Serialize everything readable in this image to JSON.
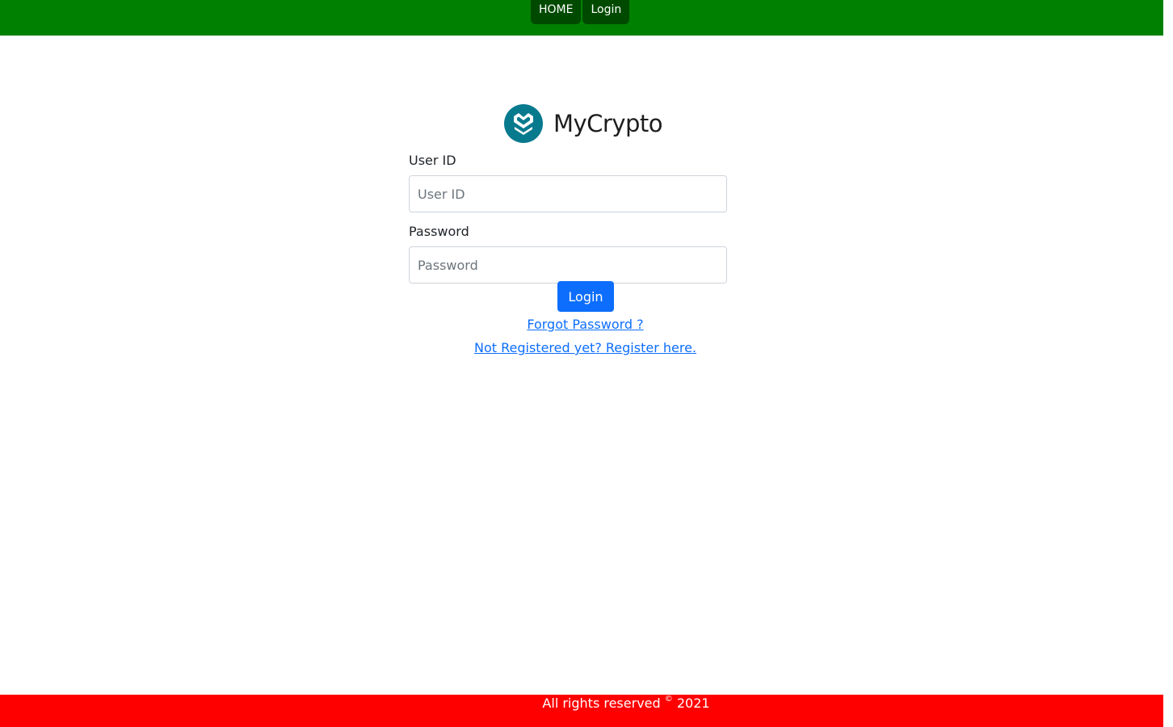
{
  "nav": {
    "items": [
      {
        "label": "HOME"
      },
      {
        "label": "Login"
      }
    ]
  },
  "logo": {
    "text": "MyCrypto",
    "icon": "mycrypto-logo-icon",
    "color": "#087a8e"
  },
  "form": {
    "user_id_label": "User ID",
    "user_id_placeholder": "User ID",
    "user_id_value": "",
    "password_label": "Password",
    "password_placeholder": "Password",
    "password_value": "",
    "login_button": "Login",
    "forgot_link": "Forgot Password ?",
    "register_link": "Not Registered yet? Register here."
  },
  "footer": {
    "text_before": "All rights reserved ",
    "symbol": "©",
    "year": " 2021"
  },
  "colors": {
    "navbar": "#008000",
    "nav_button": "#004a00",
    "primary": "#0d6efd",
    "footer": "#ff0000"
  }
}
